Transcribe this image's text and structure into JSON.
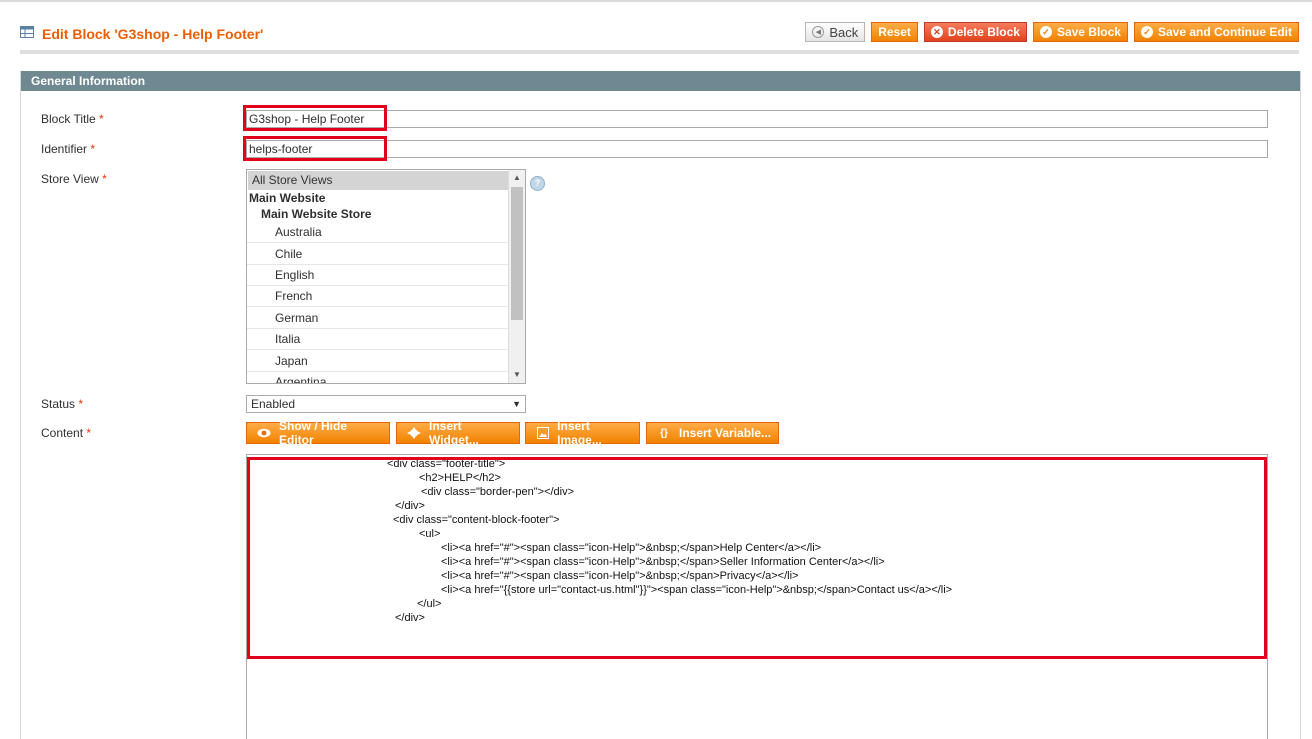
{
  "page": {
    "title": "Edit Block 'G3shop - Help Footer'"
  },
  "toolbar": {
    "back_label": "Back",
    "reset_label": "Reset",
    "delete_label": "Delete Block",
    "save_label": "Save Block",
    "save_continue_label": "Save and Continue Edit"
  },
  "section": {
    "title": "General Information"
  },
  "form": {
    "block_title": {
      "label": "Block Title",
      "required": "*",
      "value": "G3shop - Help Footer"
    },
    "identifier": {
      "label": "Identifier",
      "required": "*",
      "value": "helps-footer"
    },
    "store_view": {
      "label": "Store View",
      "required": "*",
      "options": {
        "all": "All Store Views",
        "website": "Main Website",
        "store": "Main Website Store",
        "views": [
          "Australia",
          "Chile",
          "English",
          "French",
          "German",
          "Italia",
          "Japan",
          "Argentina"
        ]
      }
    },
    "status": {
      "label": "Status",
      "required": "*",
      "value": "Enabled"
    },
    "content": {
      "label": "Content",
      "required": "*",
      "buttons": {
        "show_hide": "Show / Hide Editor",
        "insert_widget": "Insert Widget...",
        "insert_image": "Insert Image...",
        "insert_variable": "Insert Variable..."
      },
      "lines": [
        "<div class=\"footer-title\">",
        "<h2>HELP</h2>",
        "<div class=\"border-pen\"></div>",
        "</div>",
        "<div class=\"content-block-footer\">",
        "<ul>",
        "<li><a href=\"#\"><span class=\"icon-Help\">&nbsp;</span>Help Center</a></li>",
        "<li><a href=\"#\"><span class=\"icon-Help\">&nbsp;</span>Seller Information Center</a></li>",
        "<li><a href=\"#\"><span class=\"icon-Help\">&nbsp;</span>Privacy</a></li>",
        "<li><a href=\"{{store url=\"contact-us.html\"}}\"><span class=\"icon-Help\">&nbsp;</span>Contact us</a></li>",
        "</ul>",
        "</div>"
      ]
    }
  },
  "colors": {
    "accent": "#eb5e00",
    "button_orange": "#f18200",
    "section_header": "#6f8992",
    "highlight": "#e3001b"
  },
  "icons": {
    "title": "grid-icon",
    "back": "arrow-left-icon",
    "delete": "x-circle-icon",
    "save": "check-circle-icon",
    "help": "question-icon",
    "show_hide": "eye-icon",
    "widget": "widget-icon",
    "image": "image-icon",
    "variable": "braces-icon"
  }
}
